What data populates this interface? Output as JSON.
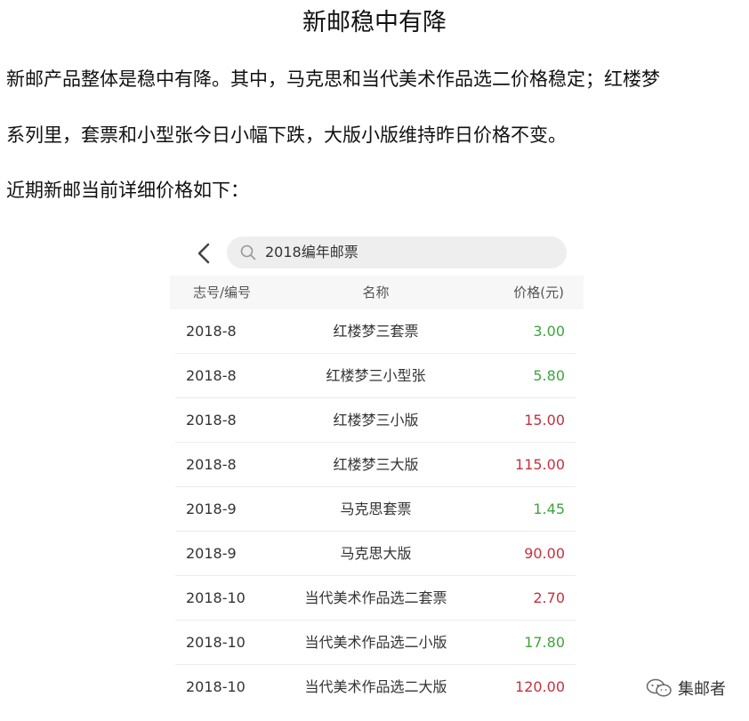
{
  "article": {
    "title": "新邮稳中有降",
    "paragraph1_line1": "新邮产品整体是稳中有降。其中，马克思和当代美术作品选二价格稳定；红楼梦",
    "paragraph1_line2": "系列里，套票和小型张今日小幅下跌，大版小版维持昨日价格不变。",
    "paragraph2": "近期新邮当前详细价格如下："
  },
  "app": {
    "back_icon": "chevron-left-icon",
    "search": {
      "icon": "search-icon",
      "value": "2018编年邮票"
    },
    "table": {
      "headers": {
        "code": "志号/编号",
        "name": "名称",
        "price": "价格(元)"
      },
      "rows": [
        {
          "code": "2018-8",
          "name": "红楼梦三套票",
          "price": "3.00",
          "trend": "down"
        },
        {
          "code": "2018-8",
          "name": "红楼梦三小型张",
          "price": "5.80",
          "trend": "down"
        },
        {
          "code": "2018-8",
          "name": "红楼梦三小版",
          "price": "15.00",
          "trend": "up"
        },
        {
          "code": "2018-8",
          "name": "红楼梦三大版",
          "price": "115.00",
          "trend": "up"
        },
        {
          "code": "2018-9",
          "name": "马克思套票",
          "price": "1.45",
          "trend": "down"
        },
        {
          "code": "2018-9",
          "name": "马克思大版",
          "price": "90.00",
          "trend": "up"
        },
        {
          "code": "2018-10",
          "name": "当代美术作品选二套票",
          "price": "2.70",
          "trend": "up"
        },
        {
          "code": "2018-10",
          "name": "当代美术作品选二小版",
          "price": "17.80",
          "trend": "down"
        },
        {
          "code": "2018-10",
          "name": "当代美术作品选二大版",
          "price": "120.00",
          "trend": "up"
        }
      ]
    },
    "colors": {
      "price_down": "#3ea63e",
      "price_up": "#c8303f"
    }
  },
  "watermark": {
    "icon": "wechat-icon",
    "text": "集邮者"
  }
}
